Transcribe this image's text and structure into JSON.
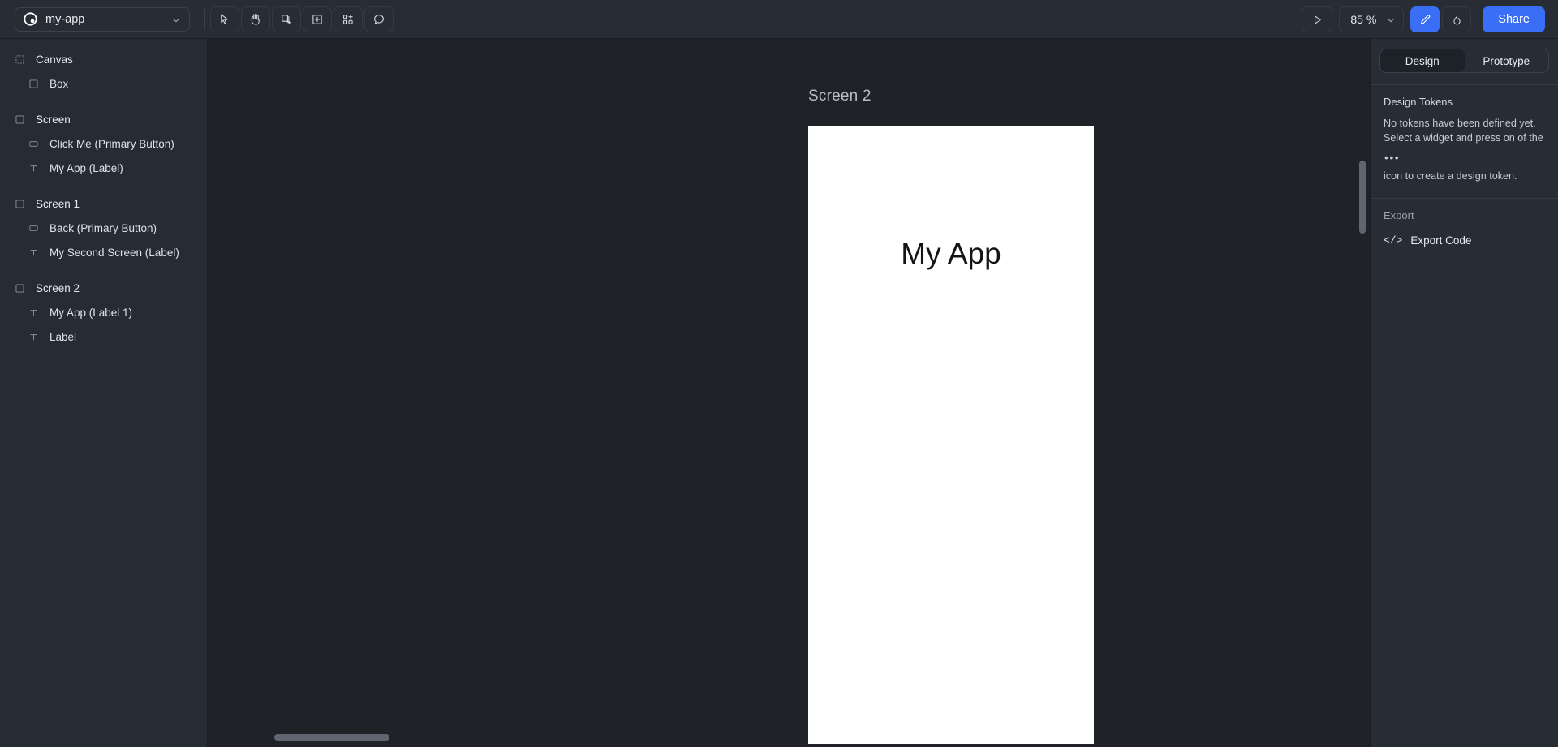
{
  "topbar": {
    "logo_icon": "app-logo-icon",
    "project_name": "my-app",
    "project_chevron_icon": "chevron-down-icon",
    "tools": [
      {
        "name": "select-tool",
        "icon": "cursor-arrow-icon"
      },
      {
        "name": "hand-tool",
        "icon": "hand-icon"
      },
      {
        "name": "add-screen-tool",
        "icon": "add-screen-icon"
      },
      {
        "name": "add-box-tool",
        "icon": "plus-square-icon"
      },
      {
        "name": "components-tool",
        "icon": "components-grid-plus-icon"
      },
      {
        "name": "comment-tool",
        "icon": "comment-bubble-icon"
      }
    ],
    "play_icon": "play-icon",
    "zoom_value": "85 %",
    "zoom_chevron_icon": "chevron-down-icon",
    "edit_mode_icon": "pencil-icon",
    "interact_mode_icon": "flame-icon",
    "share_label": "Share"
  },
  "layers": {
    "groups": [
      {
        "parent": {
          "label": "Canvas",
          "icon": "dashed-square-icon"
        },
        "children": [
          {
            "label": "Box",
            "icon": "square-icon"
          }
        ]
      },
      {
        "parent": {
          "label": "Screen",
          "icon": "square-icon"
        },
        "children": [
          {
            "label": "Click Me (Primary Button)",
            "icon": "button-icon"
          },
          {
            "label": "My App (Label)",
            "icon": "text-icon"
          }
        ]
      },
      {
        "parent": {
          "label": "Screen 1",
          "icon": "square-icon"
        },
        "children": [
          {
            "label": "Back (Primary Button)",
            "icon": "button-icon"
          },
          {
            "label": "My Second Screen (Label)",
            "icon": "text-icon"
          }
        ]
      },
      {
        "parent": {
          "label": "Screen 2",
          "icon": "square-icon"
        },
        "children": [
          {
            "label": "My App (Label 1)",
            "icon": "text-icon"
          },
          {
            "label": "Label",
            "icon": "text-icon"
          }
        ]
      }
    ]
  },
  "canvas": {
    "frame_title": "Screen 2",
    "artboard_text": "My App",
    "artboard_bg": "#ffffff",
    "background": "#1f2328"
  },
  "inspector": {
    "tabs": [
      {
        "label": "Design",
        "active": true
      },
      {
        "label": "Prototype",
        "active": false
      }
    ],
    "tokens_title": "Design Tokens",
    "tokens_empty_part1": "No tokens have been defined yet. Select a widget and press on of the",
    "tokens_empty_dots": "•••",
    "tokens_empty_part2": "icon to create a design token.",
    "export_title": "Export",
    "export_code_label": "Export Code",
    "export_code_icon": "code-brackets-icon"
  },
  "theme": {
    "accent": "#3b6ef6",
    "panel_bg": "#272c35",
    "canvas_bg": "#1f2328"
  }
}
